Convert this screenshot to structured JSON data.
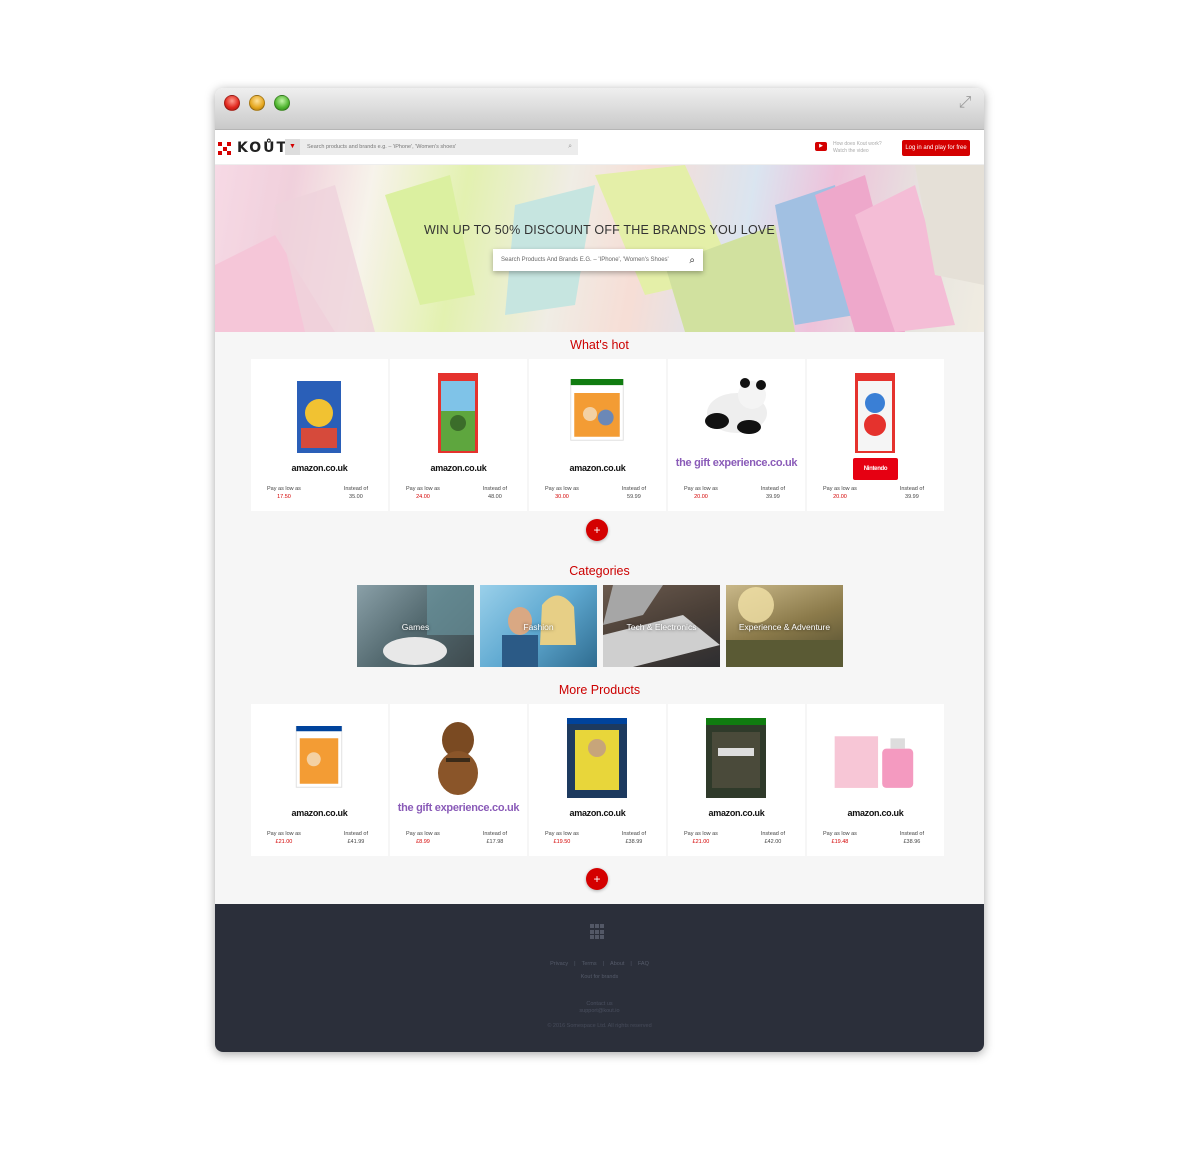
{
  "nav": {
    "logo": "KOŮT",
    "search_placeholder": "Search products and brands e.g. – 'iPhone', 'Women's shoes'",
    "how_line1": "How does Kout work?",
    "how_line2": "Watch the video",
    "login_label": "Log in and play for free"
  },
  "hero": {
    "title": "WIN UP TO 50% DISCOUNT OFF THE BRANDS YOU LOVE",
    "search_placeholder": "Search Products And Brands E.G. – 'IPhone', 'Women's Shoes'"
  },
  "whats_hot": {
    "title": "What's hot",
    "pay_label": "Pay as low as",
    "instead_label": "Instead of",
    "items": [
      {
        "brand": "amazon.co.uk",
        "pay": "17.50",
        "instead": "35.00"
      },
      {
        "brand": "amazon.co.uk",
        "pay": "24.00",
        "instead": "48.00"
      },
      {
        "brand": "amazon.co.uk",
        "pay": "30.00",
        "instead": "59.99"
      },
      {
        "brand": "the gift experience.co.uk",
        "pay": "20.00",
        "instead": "39.99"
      },
      {
        "brand": "Nintendo",
        "pay": "20.00",
        "instead": "39.99"
      }
    ],
    "more": "+"
  },
  "categories": {
    "title": "Categories",
    "items": [
      "Games",
      "Fashion",
      "Tech & Electronics",
      "Experience & Adventure"
    ]
  },
  "more_products": {
    "title": "More Products",
    "pay_label": "Pay as low as",
    "instead_label": "Instead of",
    "items": [
      {
        "brand": "amazon.co.uk",
        "pay": "£21.00",
        "instead": "£41.99"
      },
      {
        "brand": "the gift experience.co.uk",
        "pay": "£8.99",
        "instead": "£17.98"
      },
      {
        "brand": "amazon.co.uk",
        "pay": "£19.50",
        "instead": "£38.99"
      },
      {
        "brand": "amazon.co.uk",
        "pay": "£21.00",
        "instead": "£42.00"
      },
      {
        "brand": "amazon.co.uk",
        "pay": "£19.48",
        "instead": "£38.96"
      }
    ],
    "more": "+"
  },
  "footer": {
    "links": [
      "Privacy",
      "Terms",
      "About",
      "FAQ"
    ],
    "brands": "Kout for brands",
    "contact_label": "Contact us",
    "contact_email": "support@kout.io",
    "copyright": "© 2016 Somespace Ltd. All rights reserved"
  },
  "colors": {
    "accent": "#d40000",
    "footer_bg": "#2b2f3a"
  }
}
